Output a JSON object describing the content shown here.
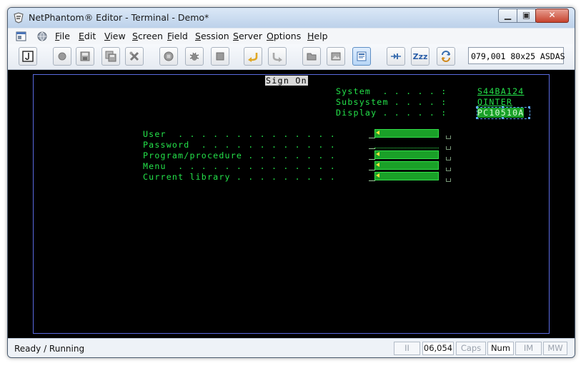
{
  "window": {
    "title": "NetPhantom® Editor - Terminal - Demo*"
  },
  "menu": {
    "items": [
      {
        "label": "File",
        "key": "F",
        "rest": "ile"
      },
      {
        "label": "Edit",
        "key": "E",
        "rest": "dit"
      },
      {
        "label": "View",
        "key": "V",
        "rest": "iew"
      },
      {
        "label": "Screen",
        "key": "S",
        "rest": "creen"
      },
      {
        "label": "Field",
        "key": "F",
        "rest": "ield"
      },
      {
        "label": "Session",
        "key": "S",
        "rest": "ession"
      },
      {
        "label": "Server",
        "key": "S",
        "rest": "erver"
      },
      {
        "label": "Options",
        "key": "O",
        "rest": "ptions"
      },
      {
        "label": "Help",
        "key": "H",
        "rest": "elp"
      }
    ]
  },
  "toolbar": {
    "position_info": "079,001  80x25  ASDAS",
    "buttons": [
      "java-icon",
      "record-icon",
      "save-icon",
      "save-all-icon",
      "tools-icon",
      "stop-circle-icon",
      "bug-icon",
      "stop-icon",
      "undo-icon",
      "redo-icon",
      "folder-icon",
      "image-icon",
      "screen-view-icon",
      "step-icon",
      "sleep-icon",
      "refresh-icon"
    ],
    "sleep_label": "Zzz"
  },
  "terminal": {
    "heading": "Sign On",
    "system_label": "System  . . . . . :",
    "system_value": "S44BA124",
    "subsystem_label": "Subsystem . . . . :",
    "subsystem_value": "QINTER",
    "display_label": "Display . . . . . :",
    "display_value": "PC10510A",
    "fields": [
      {
        "label": "User  . . . . . . . . . . . . . .",
        "has_box": true
      },
      {
        "label": "Password  . . . . . . . . . . . .",
        "has_box": false
      },
      {
        "label": "Program/procedure . . . . . . . .",
        "has_box": true
      },
      {
        "label": "Menu  . . . . . . . . . . . . . .",
        "has_box": true
      },
      {
        "label": "Current library . . . . . . . . .",
        "has_box": true
      }
    ]
  },
  "statusbar": {
    "status": "Ready / Running",
    "ii": "II",
    "cursor": "06,054",
    "caps": "Caps",
    "num": "Num",
    "im": "IM",
    "mw": "MW"
  }
}
